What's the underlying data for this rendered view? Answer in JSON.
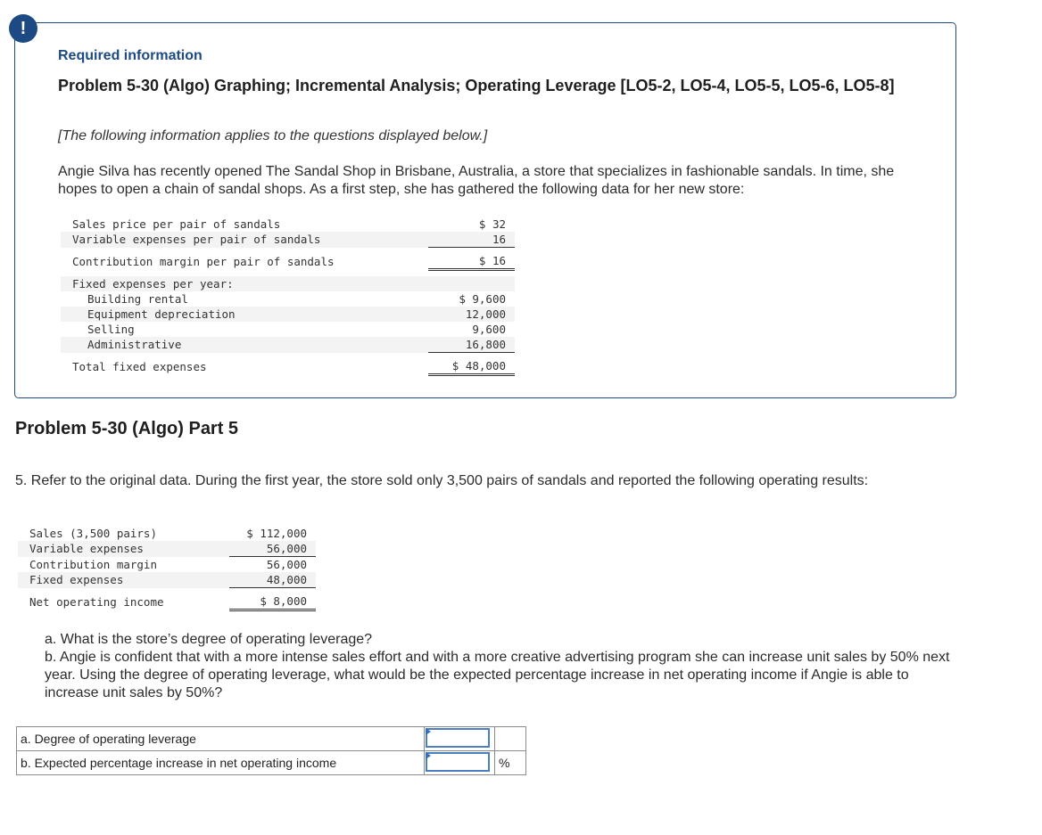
{
  "alert": {
    "icon": "exclamation-icon",
    "glyph": "!"
  },
  "info_box": {
    "required_label": "Required information",
    "problem_title": "Problem 5-30 (Algo) Graphing; Incremental Analysis; Operating Leverage [LO5-2, LO5-4, LO5-5, LO5-6, LO5-8]",
    "applies_note": "[The following information applies to the questions displayed below.]",
    "intro": "Angie Silva has recently opened The Sandal Shop in Brisbane, Australia, a store that specializes in fashionable sandals. In time, she hopes to open a chain of sandal shops. As a first step, she has gathered the following data for her new store:",
    "store_data": {
      "sales_price": {
        "label": "Sales price per pair of sandals",
        "value": "$ 32"
      },
      "variable_expenses": {
        "label": "Variable expenses per pair of sandals",
        "value": "16"
      },
      "contribution_margin": {
        "label": "Contribution margin per pair of sandals",
        "value": "$ 16"
      },
      "fixed_header": {
        "label": "Fixed expenses per year:"
      },
      "building_rental": {
        "label": "Building rental",
        "value": "$ 9,600"
      },
      "equipment_depreciation": {
        "label": "Equipment depreciation",
        "value": "12,000"
      },
      "selling": {
        "label": "Selling",
        "value": "9,600"
      },
      "administrative": {
        "label": "Administrative",
        "value": "16,800"
      },
      "total_fixed": {
        "label": "Total fixed expenses",
        "value": "$ 48,000"
      }
    }
  },
  "part": {
    "title": "Problem 5-30 (Algo) Part 5",
    "question": "5. Refer to the original data. During the first year, the store sold only 3,500 pairs of sandals and reported the following operating results:",
    "results": {
      "sales": {
        "label": "Sales (3,500 pairs)",
        "value": "$ 112,000"
      },
      "variable_expenses": {
        "label": "Variable expenses",
        "value": "56,000"
      },
      "contribution_margin": {
        "label": "Contribution margin",
        "value": "56,000"
      },
      "fixed_expenses": {
        "label": "Fixed expenses",
        "value": "48,000"
      },
      "net_operating_income": {
        "label": "Net operating income",
        "value": "$ 8,000"
      }
    },
    "sub_a": "a. What is the store’s degree of operating leverage?",
    "sub_b": "b. Angie is confident that with a more intense sales effort and with a more creative advertising program she can increase unit sales by 50% next year. Using the degree of operating leverage, what would be the expected percentage increase in net operating income if Angie is able to increase unit sales by 50%?",
    "answers": [
      {
        "label": "a. Degree of operating leverage",
        "value": "",
        "unit": ""
      },
      {
        "label": "b. Expected percentage increase in net operating income",
        "value": "",
        "unit": "%"
      }
    ]
  }
}
